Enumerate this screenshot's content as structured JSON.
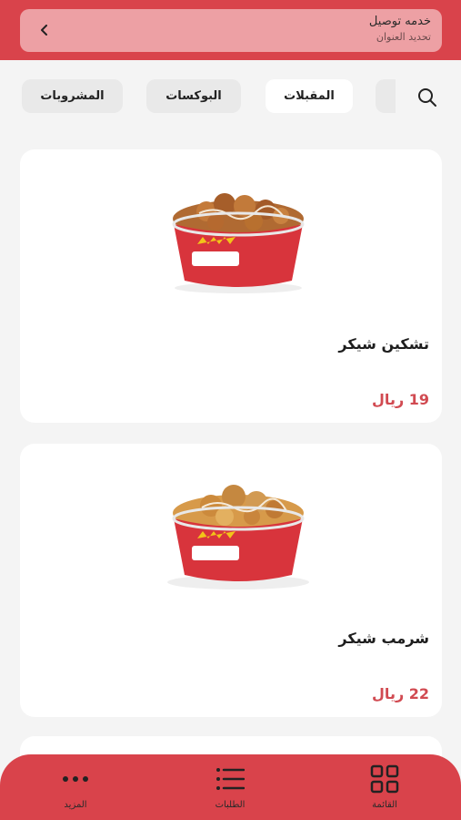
{
  "header": {
    "delivery_title": "خدمه توصيل",
    "delivery_subtitle": "تحديد العنوان"
  },
  "tabs": [
    {
      "label": "المشروبات",
      "active": false
    },
    {
      "label": "البوكسات",
      "active": false
    },
    {
      "label": "المقبلات",
      "active": true
    }
  ],
  "products": [
    {
      "name": "تشكين شيكر",
      "price": "19 ريال"
    },
    {
      "name": "شرمب شيكر",
      "price": "22 ريال"
    }
  ],
  "bottom_nav": [
    {
      "label": "المزيد",
      "icon": "more-icon"
    },
    {
      "label": "الطلبات",
      "icon": "list-icon"
    },
    {
      "label": "القائمة",
      "icon": "grid-icon"
    }
  ],
  "colors": {
    "brand": "#d9434b",
    "price": "#d14a51",
    "delivery_card": "#eda0a4"
  }
}
